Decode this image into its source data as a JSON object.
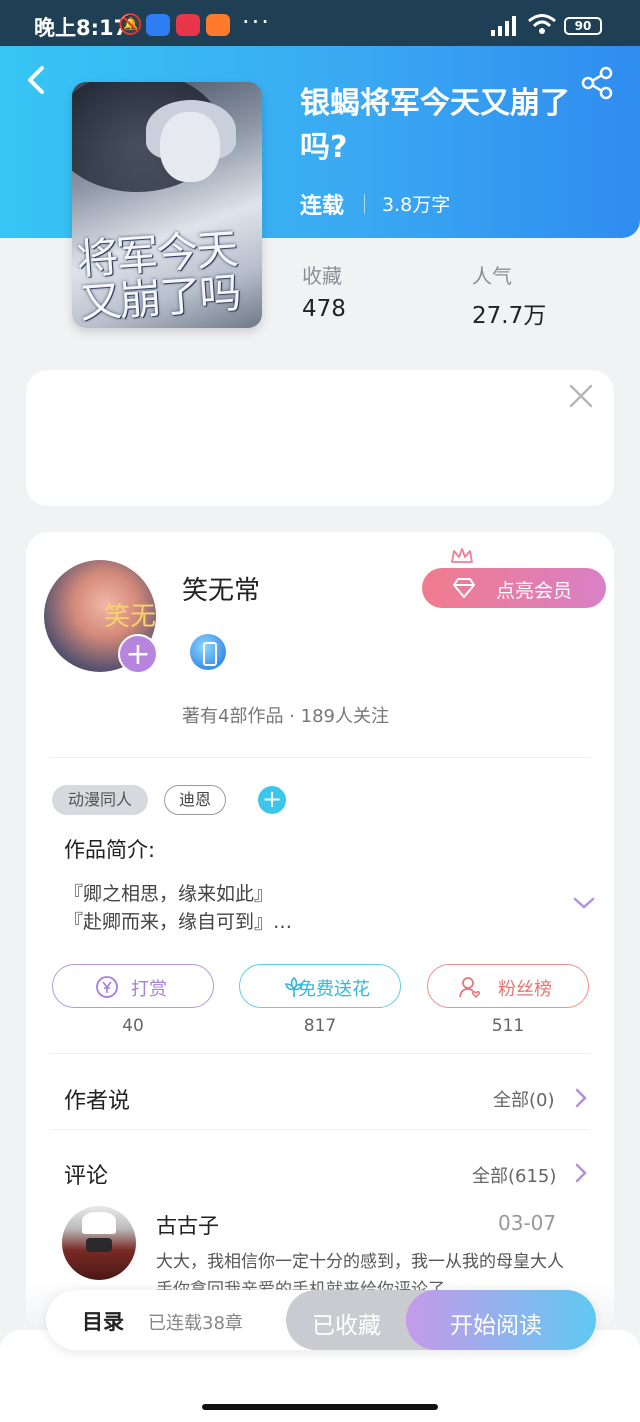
{
  "status_bar": {
    "time": "晚上8:17",
    "battery": "90"
  },
  "book": {
    "title": "银蝎将军今天又崩了吗?",
    "status": "连载",
    "words": "3.8万字",
    "cover_title_art": "将军今天又崩了吗"
  },
  "stats": [
    {
      "label": "收藏",
      "value": "478"
    },
    {
      "label": "人气",
      "value": "27.7万"
    }
  ],
  "author": {
    "name": "笑无常",
    "avatar_text": "笑无",
    "meta": "著有4部作品 · 189人关注",
    "vip_button": "点亮会员"
  },
  "tags": [
    "动漫同人",
    "迪恩"
  ],
  "intro": {
    "title": "作品简介:",
    "lines": [
      "『卿之相思，缘来如此』",
      "『赴卿而来，缘自可到』…"
    ]
  },
  "actions": [
    {
      "label": "打赏",
      "count": "40",
      "icon": "yen-coin-icon"
    },
    {
      "label": "免费送花",
      "count": "817",
      "icon": "flower-icon"
    },
    {
      "label": "粉丝榜",
      "count": "511",
      "icon": "fan-user-icon"
    }
  ],
  "author_says": {
    "title": "作者说",
    "link": "全部(0)"
  },
  "comments": {
    "title": "评论",
    "link": "全部(615)",
    "items": [
      {
        "user": "古古子",
        "date": "03-07",
        "text": "大大，我相信你一定十分的感到，我一从我的母皇大人手你拿回我亲爱的手机就来给你评论了"
      }
    ]
  },
  "bottom_bar": {
    "toc": "目录",
    "toc_sub": "已连载38章",
    "favorited": "已收藏",
    "start_reading": "开始阅读"
  },
  "colors": {
    "header_gradient": [
      "#36c6f4",
      "#2f8cf0"
    ],
    "vip_gradient": [
      "#f17b8d",
      "#d880c6"
    ],
    "read_gradient": [
      "#c699ea",
      "#5fc9f0"
    ],
    "reward": "#a57fd9",
    "flower": "#34b8d7",
    "fans": "#e87474"
  }
}
